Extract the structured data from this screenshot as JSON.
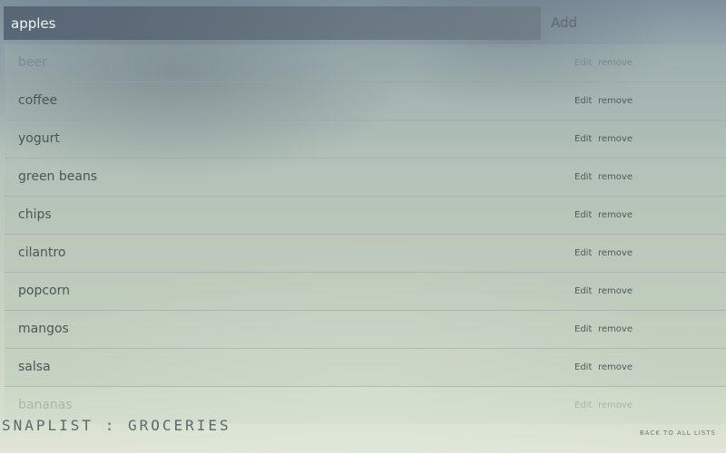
{
  "header": {
    "input_value": "apples",
    "add_label": "Add"
  },
  "items": [
    {
      "label": "beer",
      "edit": "Edit",
      "remove": "remove"
    },
    {
      "label": "coffee",
      "edit": "Edit",
      "remove": "remove"
    },
    {
      "label": "yogurt",
      "edit": "Edit",
      "remove": "remove"
    },
    {
      "label": "green beans",
      "edit": "Edit",
      "remove": "remove"
    },
    {
      "label": "chips",
      "edit": "Edit",
      "remove": "remove"
    },
    {
      "label": "cilantro",
      "edit": "Edit",
      "remove": "remove"
    },
    {
      "label": "popcorn",
      "edit": "Edit",
      "remove": "remove"
    },
    {
      "label": "mangos",
      "edit": "Edit",
      "remove": "remove"
    },
    {
      "label": "salsa",
      "edit": "Edit",
      "remove": "remove"
    },
    {
      "label": "bananas",
      "edit": "Edit",
      "remove": "remove"
    }
  ],
  "footer": {
    "title": "SNAPLIST : GROCERIES",
    "back_link": "BACK TO ALL LISTS"
  }
}
